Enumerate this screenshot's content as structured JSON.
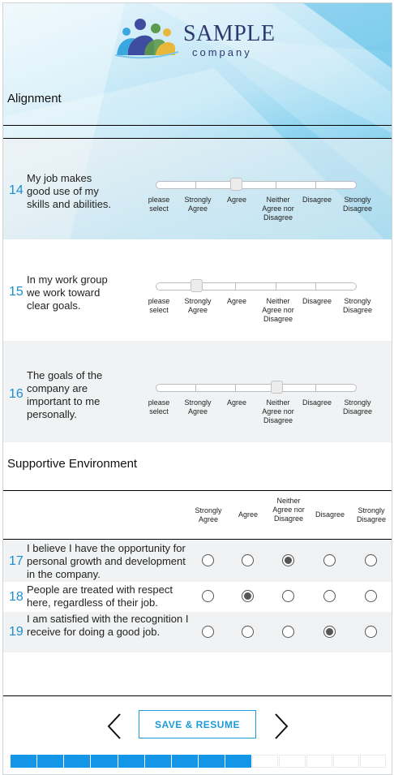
{
  "logo": {
    "title": "SAMPLE",
    "subtitle": "company"
  },
  "sections": {
    "alignment": "Alignment",
    "supportive": "Supportive Environment"
  },
  "scale_labels": [
    "please select",
    "Strongly Agree",
    "Agree",
    "Neither Agree nor Disagree",
    "Disagree",
    "Strongly Disagree"
  ],
  "slider_questions": [
    {
      "number": "14",
      "text": "My job makes good use of my skills and abilities.",
      "selected": "Agree"
    },
    {
      "number": "15",
      "text": "In my work group we work toward clear goals.",
      "selected": "Strongly Agree"
    },
    {
      "number": "16",
      "text": "The goals of the company are important to me personally.",
      "selected": "Neither Agree nor Disagree"
    }
  ],
  "matrix_headers": [
    "Strongly Agree",
    "Agree",
    "Neither Agree nor Disagree",
    "Disagree",
    "Strongly Disagree"
  ],
  "matrix_questions": [
    {
      "number": "17",
      "text": "I believe I have the opportunity for personal growth and development in the company.",
      "selected": "Neither Agree nor Disagree"
    },
    {
      "number": "18",
      "text": "People are treated with respect here, regardless of their job.",
      "selected": "Agree"
    },
    {
      "number": "19",
      "text": "I am satisfied with the recognition I receive for doing a good job.",
      "selected": "Disagree"
    }
  ],
  "navigation": {
    "save_label": "SAVE & RESUME",
    "prev_icon": "chevron-left-icon",
    "next_icon": "chevron-right-icon"
  },
  "progress": {
    "completed_segments": 9,
    "total_segments": 14
  },
  "colors": {
    "accent": "#1c9bd6",
    "number": "#1a8fd0",
    "progress": "#1396e8",
    "logo_text": "#2d3a6e"
  }
}
